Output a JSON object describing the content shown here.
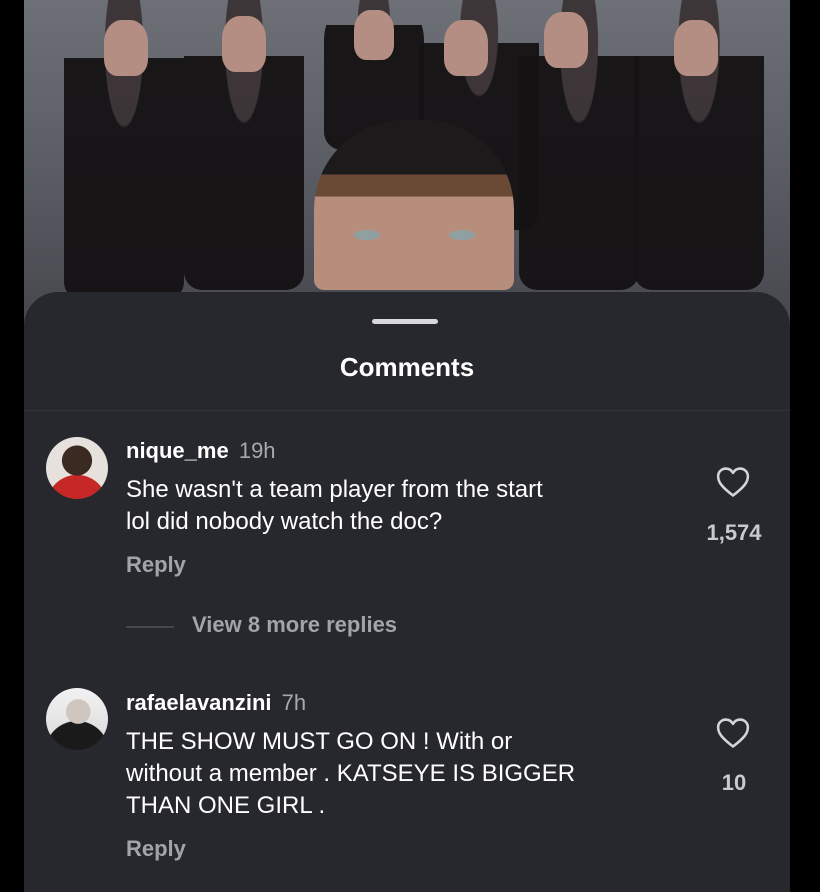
{
  "sheet": {
    "title": "Comments"
  },
  "comments": [
    {
      "username": "nique_me",
      "time": "19h",
      "lines": [
        "She wasn't a team player from the start",
        "lol did nobody watch the doc?"
      ],
      "like_count": "1,574",
      "reply_label": "Reply",
      "view_more_label": "View 8 more replies"
    },
    {
      "username": "rafaelavanzini",
      "time": "7h",
      "lines": [
        "THE SHOW MUST GO ON ! With or",
        "without a member . KATSEYE IS BIGGER",
        "THAN ONE GIRL ."
      ],
      "like_count": "10",
      "reply_label": "Reply"
    }
  ],
  "icons": {
    "like": "heart-outline-icon",
    "handle": "drag-handle"
  },
  "colors": {
    "sheet_bg": "#27282d",
    "text_primary": "#ffffff",
    "text_secondary": "#a3a4aa"
  }
}
